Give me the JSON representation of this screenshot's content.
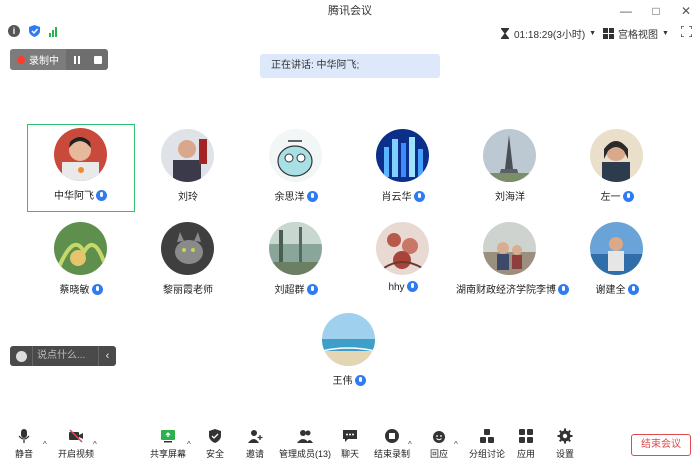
{
  "window": {
    "title": "腾讯会议"
  },
  "topbar": {
    "timer": "01:18:29(3小时)",
    "view_label": "宫格视图"
  },
  "recording": {
    "label": "录制中"
  },
  "speaking": {
    "text": "正在讲话: 中华阿飞;"
  },
  "participants": [
    {
      "name": "中华阿飞",
      "mic": "on"
    },
    {
      "name": "刘玲",
      "mic": "none"
    },
    {
      "name": "余思洋",
      "mic": "on"
    },
    {
      "name": "肖云华",
      "mic": "on"
    },
    {
      "name": "刘海洋",
      "mic": "none"
    },
    {
      "name": "左一",
      "mic": "on"
    },
    {
      "name": "蔡晓敏",
      "mic": "on"
    },
    {
      "name": "黎丽霞老师",
      "mic": "none"
    },
    {
      "name": "刘超群",
      "mic": "on"
    },
    {
      "name": "hhy",
      "mic": "on"
    },
    {
      "name": "湖南财政经济学院李博",
      "mic": "on"
    },
    {
      "name": "谢建全",
      "mic": "on"
    },
    {
      "name": "王伟",
      "mic": "on"
    }
  ],
  "chat": {
    "placeholder": "说点什么..."
  },
  "toolbar": {
    "mute": "静音",
    "video": "开启视频",
    "share": "共享屏幕",
    "security": "安全",
    "invite": "邀请",
    "members": "管理成员(13)",
    "chat": "聊天",
    "end_record": "结束录制",
    "reactions": "回应",
    "breakout": "分组讨论",
    "apps": "应用",
    "settings": "设置",
    "end_meeting": "结束会议"
  },
  "colors": {
    "accent": "#2f7bf2",
    "active_border": "#2ec16f",
    "end_red": "#e04a4a",
    "record_red": "#ff3b30"
  }
}
